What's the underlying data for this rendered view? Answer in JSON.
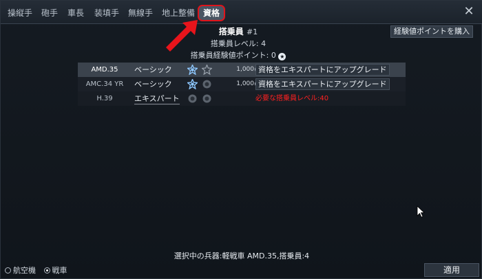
{
  "tabs": [
    {
      "label": "操縦手"
    },
    {
      "label": "砲手"
    },
    {
      "label": "車長"
    },
    {
      "label": "装填手"
    },
    {
      "label": "無線手"
    },
    {
      "label": "地上整備"
    },
    {
      "label": "資格"
    }
  ],
  "header": {
    "crew_title": "搭乗員",
    "crew_number": "#1",
    "crew_level": "搭乗員レベル: 4",
    "crew_xp": "搭乗員経験値ポイント: 0"
  },
  "buy_xp_label": "経験値ポイントを購入",
  "rows": [
    {
      "vehicle": "AMD.35",
      "level": "ベーシック",
      "cost": "1,000",
      "action": "資格をエキスパートにアップグレード"
    },
    {
      "vehicle": "AMC.34 YR",
      "level": "ベーシック",
      "cost": "1,000",
      "action": "資格をエキスパートにアップグレード"
    },
    {
      "vehicle": "H.39",
      "level": "エキスパート",
      "requirement": "必要な搭乗員レベル:40"
    }
  ],
  "selected_info": "選択中の兵器:軽戦車 AMD.35,搭乗員:4",
  "radios": [
    {
      "label": "航空機",
      "checked": false
    },
    {
      "label": "戦車",
      "checked": true
    }
  ],
  "apply_label": "適用",
  "colors": {
    "highlight": "#e0141b",
    "requirement_red": "#ff2020",
    "badge_blue": "#8ec8ff"
  }
}
